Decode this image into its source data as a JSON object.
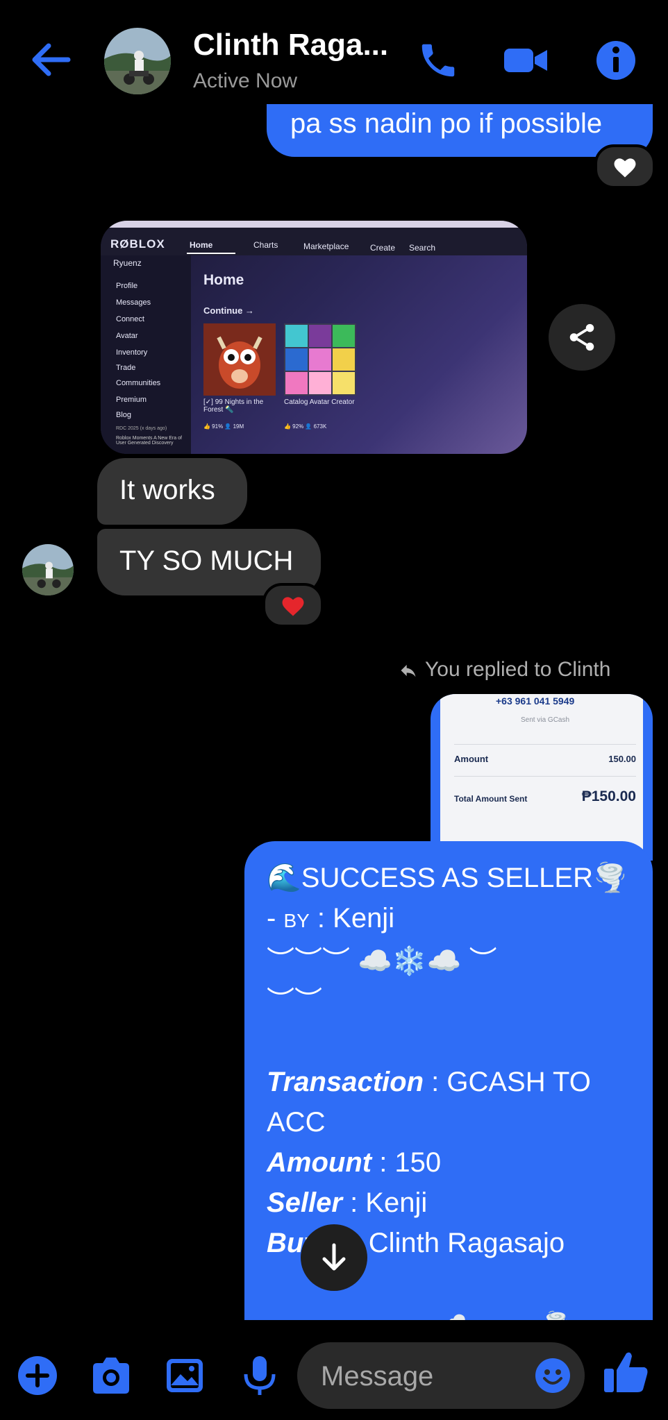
{
  "header": {
    "name": "Clinth Raga...",
    "status": "Active Now"
  },
  "messages": {
    "sent_top": "pa ss nadin po if possible",
    "it_works": "It works",
    "ty": "TY SO MUCH",
    "replied": "You replied to Clinth"
  },
  "roblox": {
    "logo": "RØBLOX",
    "user": "Ryuenz",
    "nav": [
      "Home",
      "Charts",
      "Marketplace",
      "Create",
      "Search"
    ],
    "side": [
      "Profile",
      "Messages",
      "Connect",
      "Avatar",
      "Inventory",
      "Trade",
      "Communities",
      "Premium",
      "Blog"
    ],
    "blog_note": "RDC 2025 (x days ago)",
    "blog_snip": "Roblox Moments A New Era of User Generated Discovery",
    "home": "Home",
    "continue": "Continue →",
    "game1": "[✓] 99 Nights in the Forest 🔦",
    "game1_stats": "👍 91%  👤 19M",
    "game2": "Catalog Avatar Creator",
    "game2_stats": "👍 92%  👤 673K"
  },
  "gcash": {
    "phone": "+63 961 041 5949",
    "sent_via": "Sent via GCash",
    "amount_label": "Amount",
    "amount_value": "150.00",
    "total_label": "Total Amount Sent",
    "total_value": "₱150.00"
  },
  "success": {
    "line1": "🌊SUCCESS AS SELLER🌪️",
    "by_prefix": "- ",
    "by_label": "BY",
    "by_name": " : Kenji",
    "deco1": "︶︶︶ ☁️❄️☁️ ︶",
    "deco2": "︶︶",
    "transaction_label": "Transaction",
    "transaction_value": " : GCASH TO ACC",
    "amount_label": "Amount",
    "amount_value": " : 150",
    "seller_label": "Seller",
    "seller_value": " : Kenji",
    "buyer_label": "Buyer",
    "buyer_value": " : Clinth Ragasajo",
    "footer": "────────────☁️─────🌪️"
  },
  "composer": {
    "placeholder": "Message"
  },
  "colors": {
    "accent": "#2f6df6",
    "bubble_gray": "#343434",
    "heart_red": "#e5262c"
  }
}
